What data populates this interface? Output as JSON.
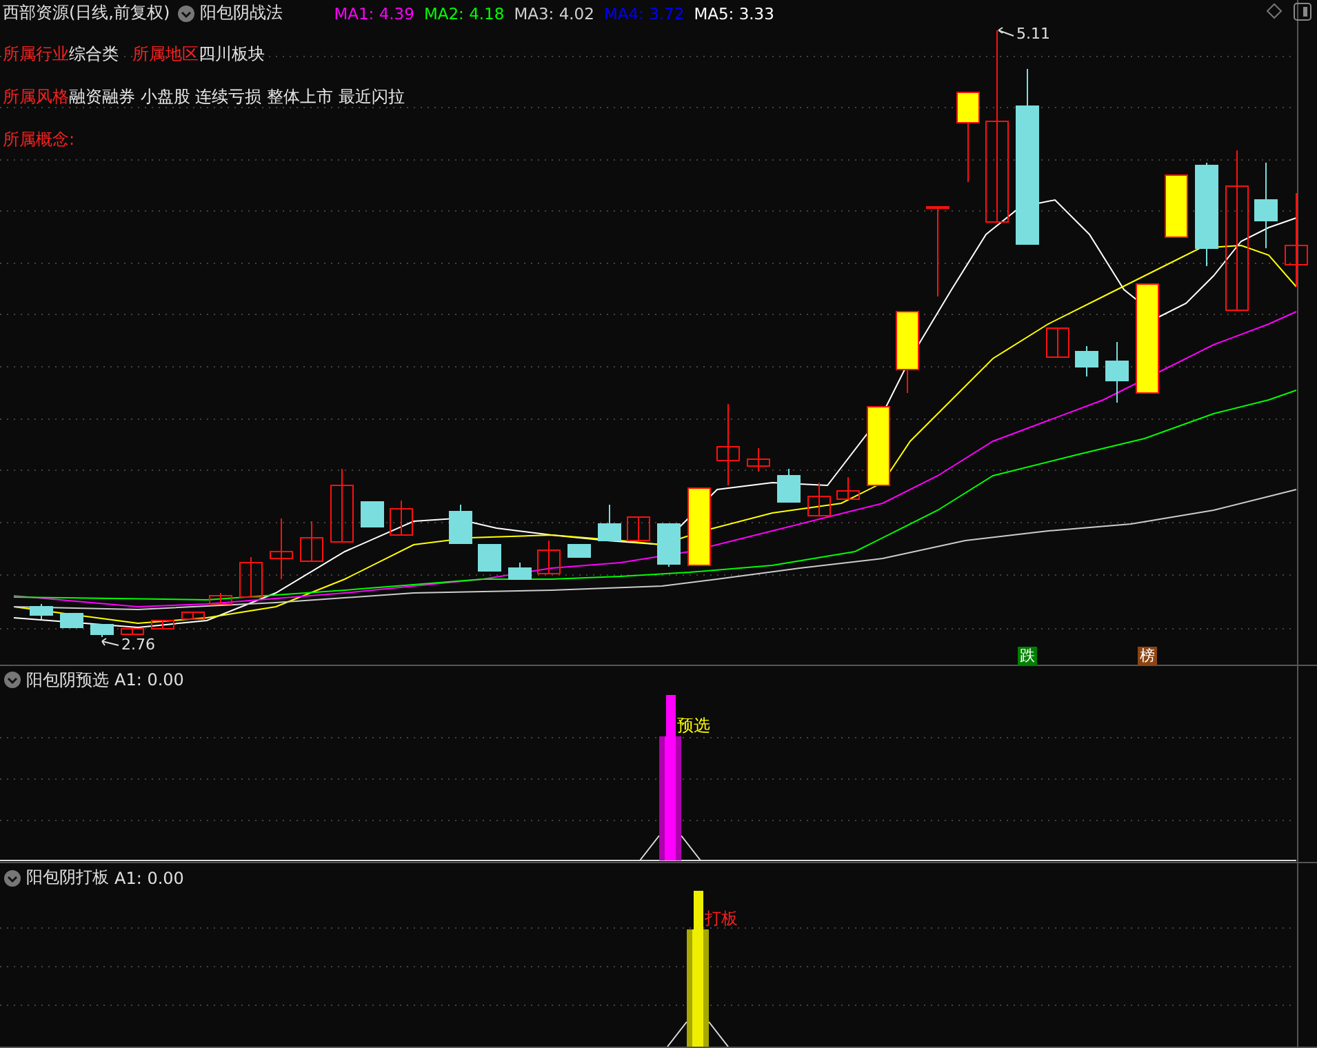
{
  "header": {
    "title": "西部资源(日线,前复权)",
    "formula": "阳包阴战法",
    "ma": [
      {
        "label": "MA1:",
        "value": "4.39",
        "color": "#ff00ff"
      },
      {
        "label": "MA2:",
        "value": "4.18",
        "color": "#00ff00"
      },
      {
        "label": "MA3:",
        "value": "4.02",
        "color": "#d0d0d0"
      },
      {
        "label": "MA4:",
        "value": "3.72",
        "color": "#0000ff"
      },
      {
        "label": "MA5:",
        "value": "3.33",
        "color": "#ffffff"
      }
    ]
  },
  "info_rows": [
    [
      {
        "label": "所属行业",
        "value": "综合类"
      },
      {
        "label": "所属地区",
        "value": "四川板块"
      }
    ],
    [
      {
        "label": "所属风格",
        "value": "融资融券 小盘股 连续亏损 整体上市 最近闪拉"
      }
    ],
    [
      {
        "label": "所属概念:"
      }
    ]
  ],
  "price_labels": {
    "high": "5.11",
    "low": "2.76"
  },
  "badges": [
    {
      "text": "跌",
      "color": "#008000"
    },
    {
      "text": "榜",
      "color": "#8b4513"
    }
  ],
  "panels": [
    {
      "kind": "preselect",
      "title": "阳包阴预选",
      "reading": "A1: 0.00",
      "signal": "预选"
    },
    {
      "kind": "board",
      "title": "阳包阴打板",
      "reading": "A1: 0.00",
      "signal": "打板"
    }
  ]
}
